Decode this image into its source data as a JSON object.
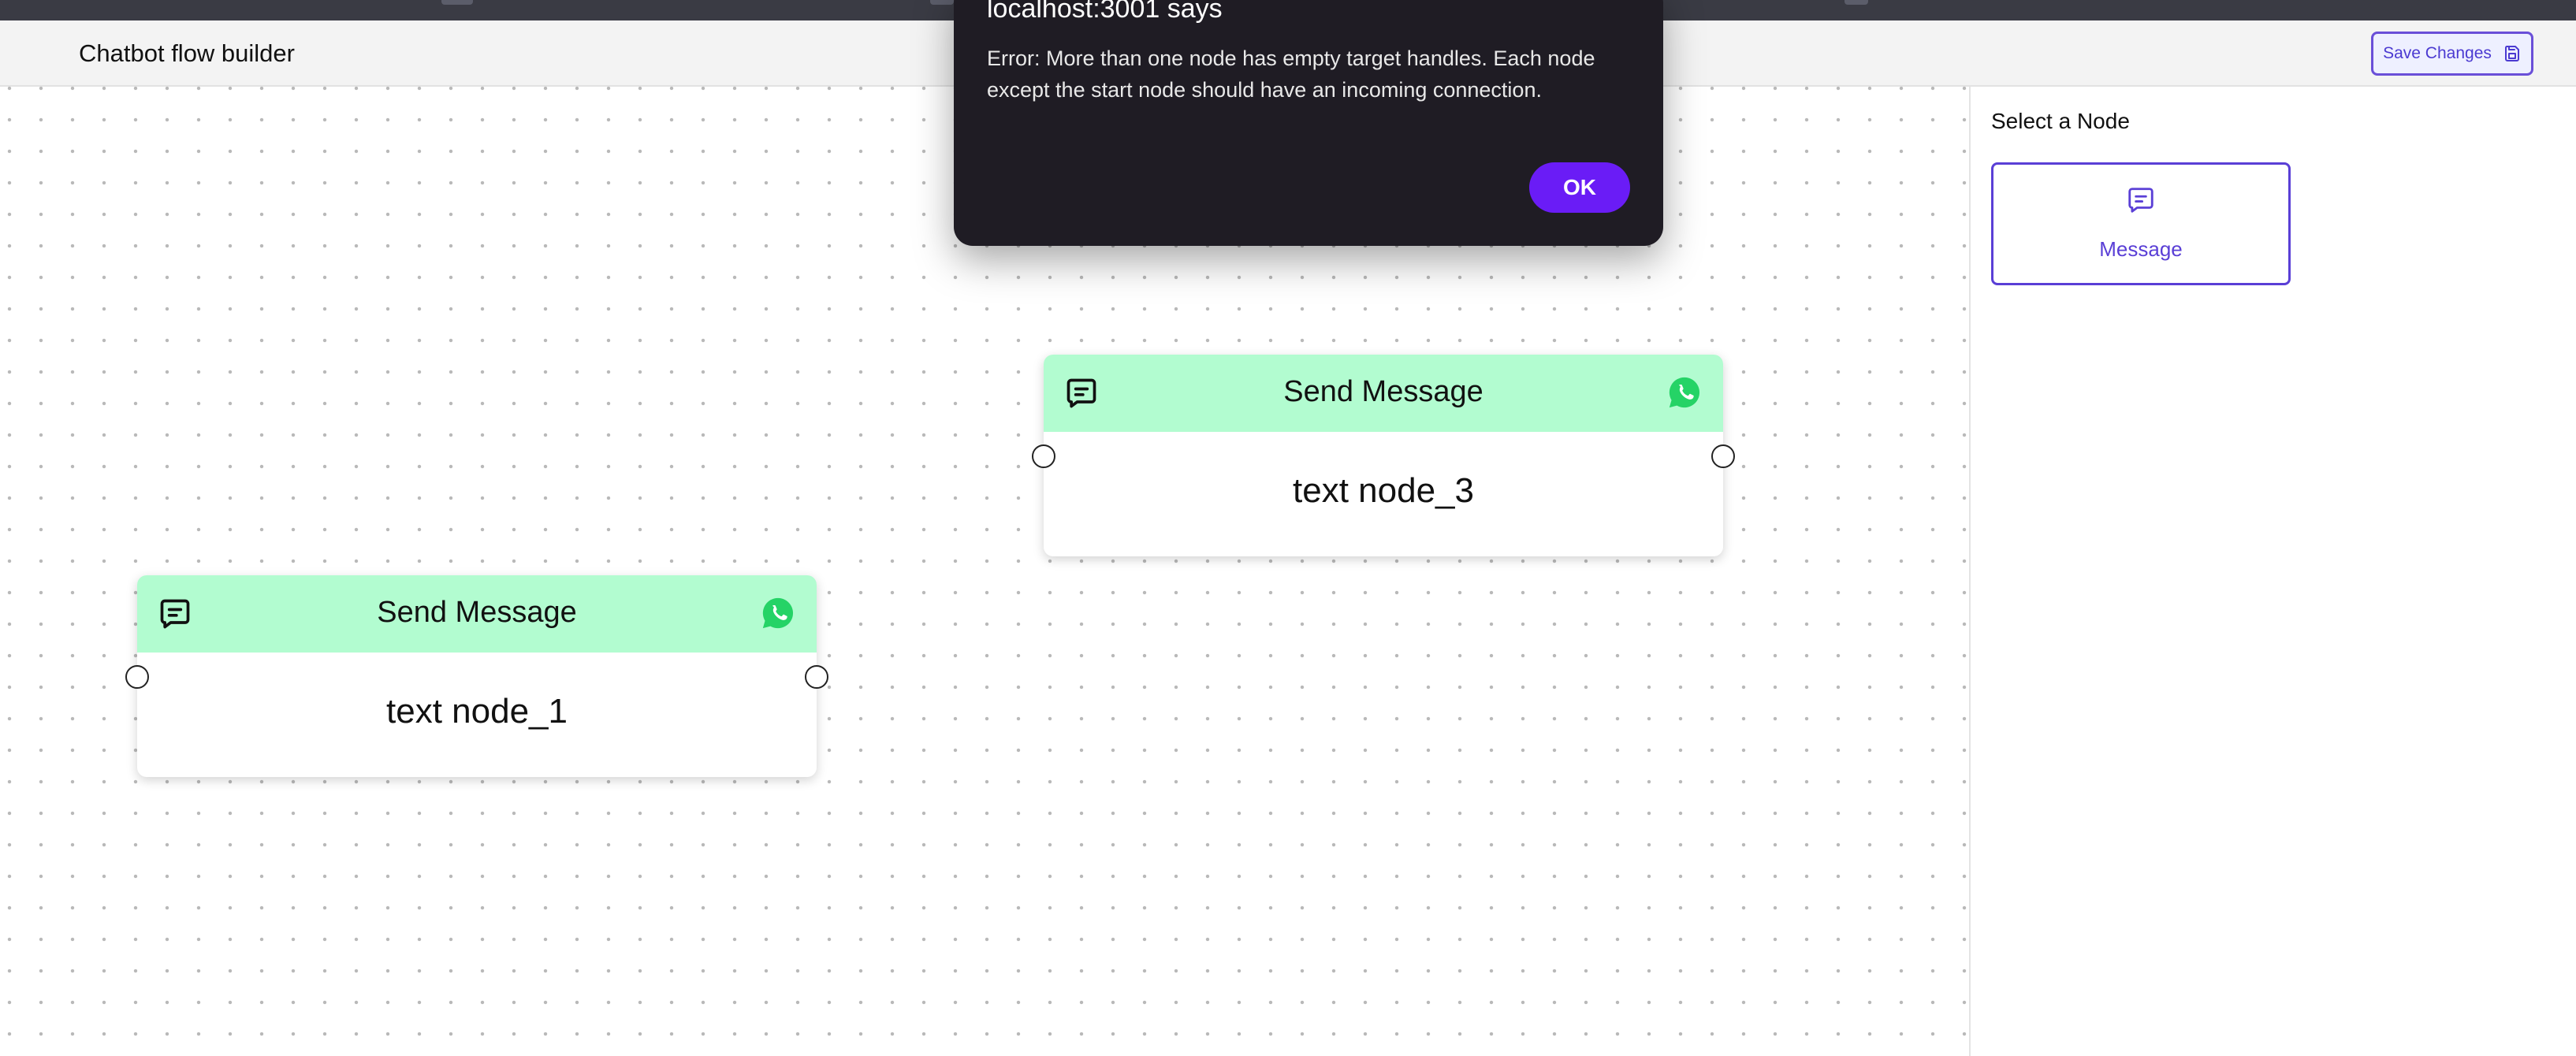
{
  "app": {
    "title": "Chatbot flow builder",
    "save_label": "Save Changes"
  },
  "sidebar": {
    "title": "Select a Node",
    "options": [
      {
        "label": "Message",
        "icon": "message-icon"
      }
    ]
  },
  "nodes": [
    {
      "header": "Send Message",
      "text": "text node_3",
      "header_color": "#b2fcd0",
      "icons": [
        "message-icon",
        "whatsapp-icon"
      ]
    },
    {
      "header": "Send Message",
      "text": "text node_1",
      "header_color": "#b2fcd0",
      "icons": [
        "message-icon",
        "whatsapp-icon"
      ]
    }
  ],
  "alert": {
    "title": "localhost:3001 says",
    "message": "Error: More than one node has empty target handles. Each node except the start node should have an incoming connection.",
    "ok_label": "OK"
  },
  "colors": {
    "accent": "#6a1cf6",
    "brand_purple": "#5a3fd6",
    "node_header": "#b2fcd0",
    "whatsapp_green": "#25d366",
    "dialog_bg": "#1f1c24"
  }
}
